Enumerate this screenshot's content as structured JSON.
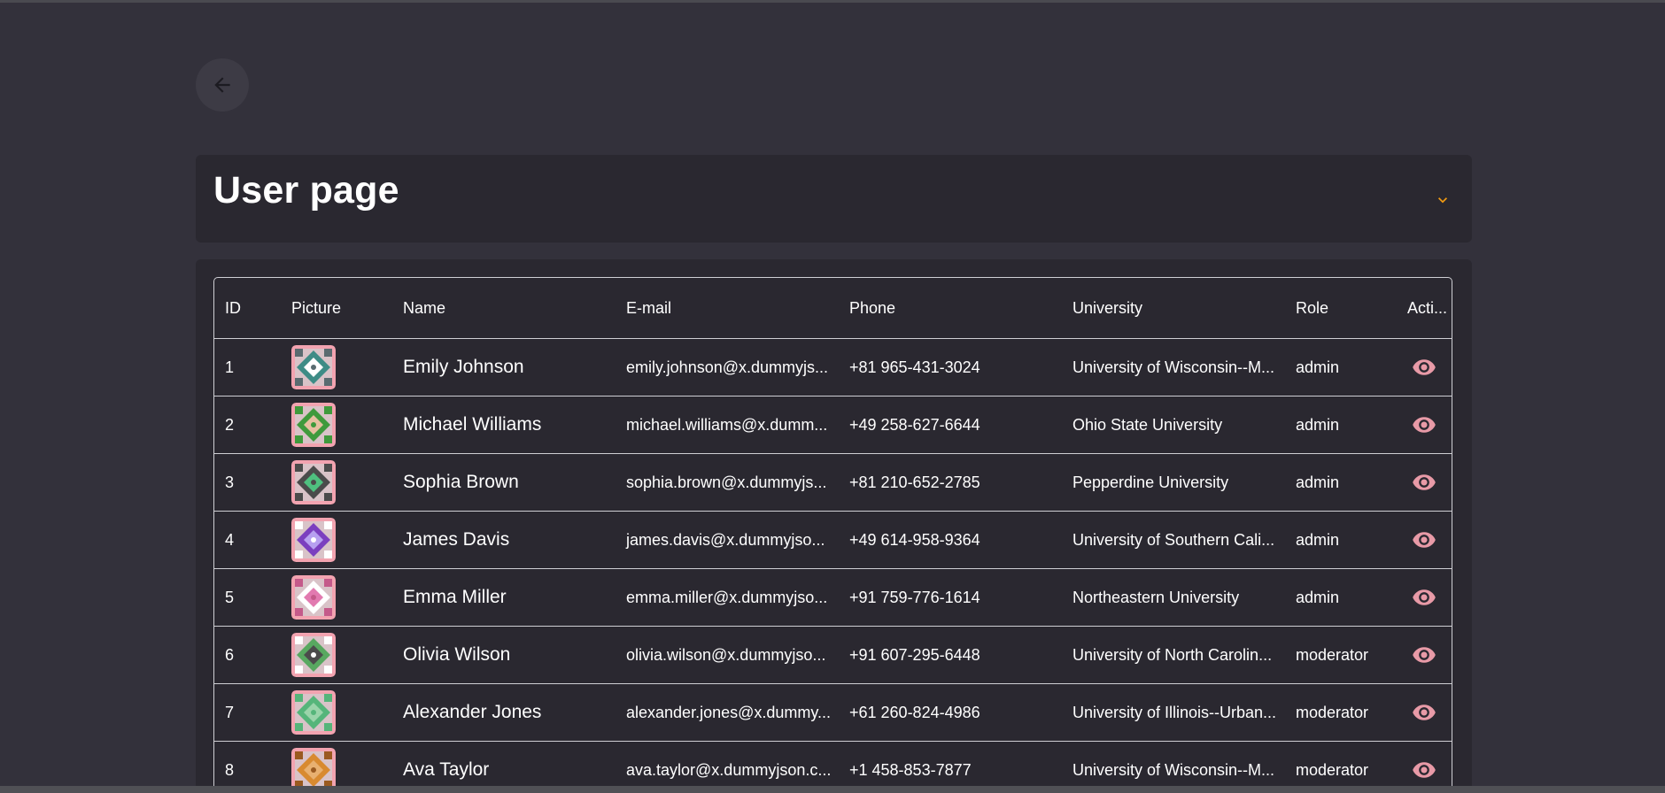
{
  "header": {
    "title": "User page"
  },
  "colors": {
    "background": "#33313b",
    "card": "#2a2830",
    "accent": "#f39c12",
    "action_icon": "#e89aa7",
    "avatar_base": "#f2a3b0"
  },
  "icons": {
    "back": "arrow-left-icon",
    "expand": "chevron-down-icon",
    "view": "eye-icon"
  },
  "table": {
    "columns": {
      "id": "ID",
      "picture": "Picture",
      "name": "Name",
      "email": "E-mail",
      "phone": "Phone",
      "university": "University",
      "role": "Role",
      "actions": "Acti..."
    },
    "rows": [
      {
        "id": "1",
        "name": "Emily Johnson",
        "email": "emily.johnson@x.dummyjs...",
        "phone": "+81 965-431-3024",
        "university": "University of Wisconsin--M...",
        "role": "admin",
        "avatar_pattern": "teal-diamond"
      },
      {
        "id": "2",
        "name": "Michael Williams",
        "email": "michael.williams@x.dumm...",
        "phone": "+49 258-627-6644",
        "university": "Ohio State University",
        "role": "admin",
        "avatar_pattern": "green-diamond"
      },
      {
        "id": "3",
        "name": "Sophia Brown",
        "email": "sophia.brown@x.dummyjs...",
        "phone": "+81 210-652-2785",
        "university": "Pepperdine University",
        "role": "admin",
        "avatar_pattern": "dark-green-diamond"
      },
      {
        "id": "4",
        "name": "James Davis",
        "email": "james.davis@x.dummyjso...",
        "phone": "+49 614-958-9364",
        "university": "University of Southern Cali...",
        "role": "admin",
        "avatar_pattern": "purple-star"
      },
      {
        "id": "5",
        "name": "Emma Miller",
        "email": "emma.miller@x.dummyjso...",
        "phone": "+91 759-776-1614",
        "university": "Northeastern University",
        "role": "admin",
        "avatar_pattern": "pink-star"
      },
      {
        "id": "6",
        "name": "Olivia Wilson",
        "email": "olivia.wilson@x.dummyjso...",
        "phone": "+91 607-295-6448",
        "university": "University of North Carolin...",
        "role": "moderator",
        "avatar_pattern": "dark-center"
      },
      {
        "id": "7",
        "name": "Alexander Jones",
        "email": "alexander.jones@x.dummy...",
        "phone": "+61 260-824-4986",
        "university": "University of Illinois--Urban...",
        "role": "moderator",
        "avatar_pattern": "green-grid"
      },
      {
        "id": "8",
        "name": "Ava Taylor",
        "email": "ava.taylor@x.dummyjson.c...",
        "phone": "+1 458-853-7877",
        "university": "University of Wisconsin--M...",
        "role": "moderator",
        "avatar_pattern": "orange-pinwheel"
      }
    ]
  }
}
